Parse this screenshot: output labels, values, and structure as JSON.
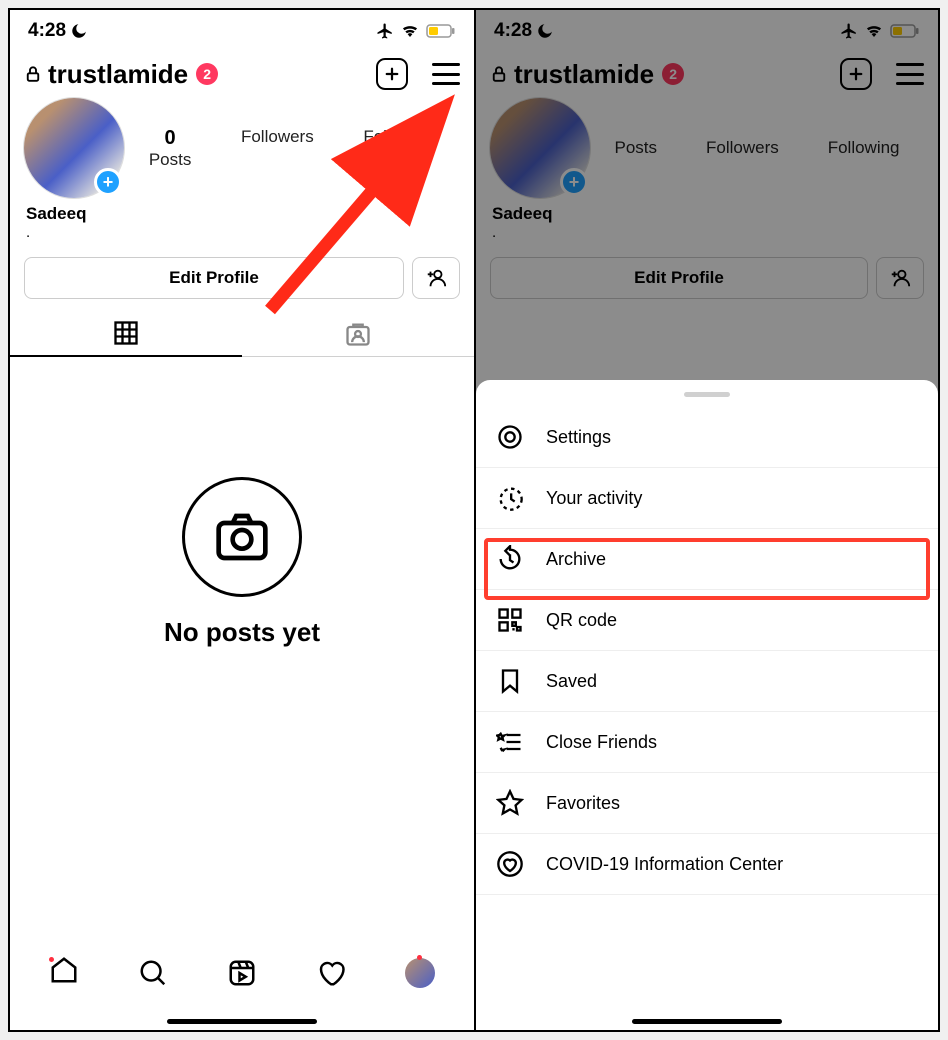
{
  "status": {
    "time": "4:28"
  },
  "header": {
    "username": "trustlamide",
    "badge": "2"
  },
  "profile": {
    "posts_count": "0",
    "posts_label": "Posts",
    "followers_label": "Followers",
    "following_label": "Following",
    "display_name": "Sadeeq",
    "bio_dot": "."
  },
  "buttons": {
    "edit_profile": "Edit Profile"
  },
  "empty_state": "No posts yet",
  "menu": {
    "settings": "Settings",
    "activity": "Your activity",
    "archive": "Archive",
    "qr": "QR code",
    "saved": "Saved",
    "close_friends": "Close Friends",
    "favorites": "Favorites",
    "covid": "COVID-19 Information Center"
  }
}
